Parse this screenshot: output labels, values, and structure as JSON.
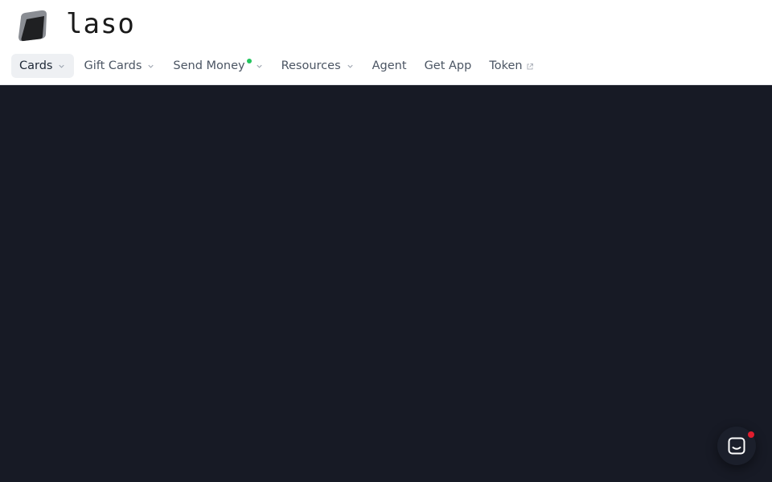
{
  "brand": {
    "name": "laso",
    "logo_icon": "laso-logo-icon"
  },
  "nav": {
    "items": [
      {
        "label": "Cards",
        "active": true,
        "has_dropdown": true
      },
      {
        "label": "Gift Cards",
        "has_dropdown": true
      },
      {
        "label": "Send Money",
        "has_dropdown": true,
        "new_indicator": true
      },
      {
        "label": "Resources",
        "has_dropdown": true
      },
      {
        "label": "Agent"
      },
      {
        "label": "Get App"
      },
      {
        "label": "Token",
        "external": true
      }
    ]
  },
  "colors": {
    "header_bg": "#ffffff",
    "page_bg": "#171a25",
    "active_tab_bg": "#eef0f3",
    "new_dot": "#22c55e",
    "notification_dot": "#e11d2e"
  },
  "chat": {
    "icon": "chat-icon",
    "has_notification": true
  }
}
